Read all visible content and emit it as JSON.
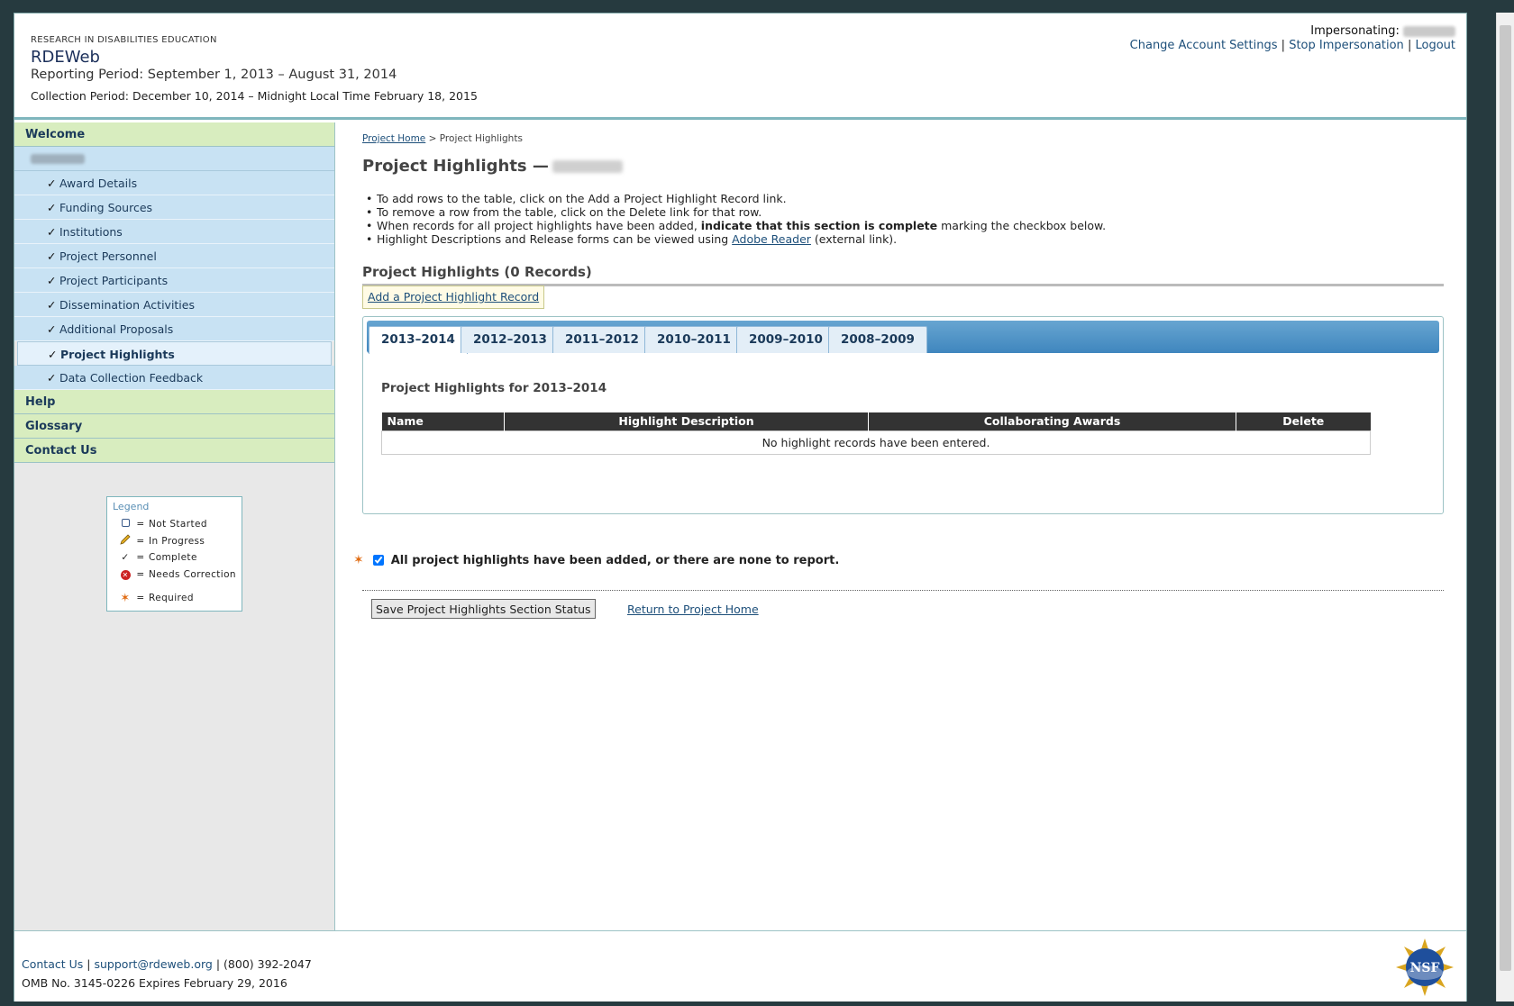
{
  "header": {
    "org": "RESEARCH IN DISABILITIES EDUCATION",
    "app_title": "RDEWeb",
    "reporting_period": "Reporting Period: September 1, 2013 – August 31, 2014",
    "collection_period": "Collection Period: December 10, 2014 – Midnight Local Time February 18, 2015",
    "impersonating_label": "Impersonating:",
    "links": {
      "change_settings": "Change Account Settings",
      "stop_impersonation": "Stop Impersonation",
      "logout": "Logout",
      "separator": "|"
    }
  },
  "sidebar": {
    "welcome": "Welcome",
    "items": [
      {
        "label": "Award Details"
      },
      {
        "label": "Funding Sources"
      },
      {
        "label": "Institutions"
      },
      {
        "label": "Project Personnel"
      },
      {
        "label": "Project Participants"
      },
      {
        "label": "Dissemination Activities"
      },
      {
        "label": "Additional Proposals"
      },
      {
        "label": "Project Highlights"
      },
      {
        "label": "Data Collection Feedback"
      }
    ],
    "help": "Help",
    "glossary": "Glossary",
    "contact": "Contact Us",
    "check": "✓"
  },
  "legend": {
    "title": "Legend",
    "eq": "=",
    "not_started": "Not Started",
    "in_progress": "In Progress",
    "complete": "Complete",
    "needs_correction": "Needs Correction",
    "required": "Required"
  },
  "main": {
    "breadcrumb_home": "Project Home",
    "breadcrumb_sep": ">",
    "breadcrumb_current": "Project Highlights",
    "title": "Project Highlights —",
    "instructions": {
      "i1": "To add rows to the table, click on the Add a Project Highlight Record link.",
      "i2": "To remove a row from the table, click on the Delete link for that row.",
      "i3_pre": "When records for all project highlights have been added, ",
      "i3_bold": "indicate that this section is complete",
      "i3_post": " marking the checkbox below.",
      "i4_pre": "Highlight Descriptions and Release forms can be viewed using ",
      "i4_link": "Adobe Reader",
      "i4_post": " (external link)."
    },
    "records_heading": "Project Highlights (0 Records)",
    "add_record": "Add a Project Highlight Record",
    "tabs": [
      {
        "label": "2013–2014"
      },
      {
        "label": "2012–2013"
      },
      {
        "label": "2011–2012"
      },
      {
        "label": "2010–2011"
      },
      {
        "label": "2009–2010"
      },
      {
        "label": "2008–2009"
      }
    ],
    "tab_content_title": "Project Highlights for 2013–2014",
    "table": {
      "headers": [
        "Name",
        "Highlight Description",
        "Collaborating Awards",
        "Delete"
      ],
      "empty_message": "No highlight records have been entered."
    },
    "complete_label": "All project highlights have been added, or there are none to report.",
    "required_star": "✶",
    "save_button": "Save Project Highlights Section Status",
    "return_link": "Return to Project Home"
  },
  "footer": {
    "contact": "Contact Us",
    "email": "support@rdeweb.org",
    "phone": "(800) 392-2047",
    "sep": "|",
    "omb": "OMB No. 3145-0226 Expires February 29, 2016",
    "logo_text": "NSF"
  },
  "colors": {
    "accent": "#1d4f7a",
    "nav_top_bg": "#d8edbf",
    "nav_item_bg": "#c8e2f3",
    "tab_bar": "#3f86be",
    "required": "#e06a10"
  }
}
